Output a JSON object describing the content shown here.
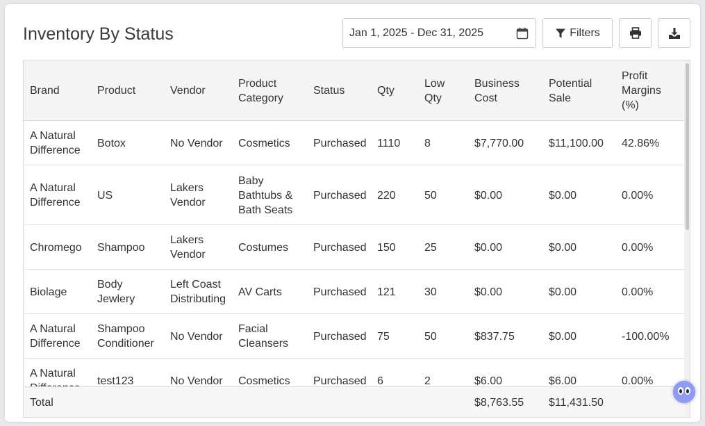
{
  "page": {
    "title": "Inventory By Status",
    "date_range": "Jan 1, 2025 - Dec 31, 2025",
    "filters_label": "Filters",
    "icons": {
      "calendar": "calendar-icon",
      "filter": "filter-icon",
      "print": "print-icon",
      "download": "download-icon"
    }
  },
  "table": {
    "headers": [
      "Brand",
      "Product",
      "Vendor",
      "Product Category",
      "Status",
      "Qty",
      "Low Qty",
      "Business Cost",
      "Potential Sale",
      "Profit Margins (%)"
    ],
    "rows": [
      [
        "A Natural Difference",
        "Botox",
        "No Vendor",
        "Cosmetics",
        "Purchased",
        "1110",
        "8",
        "$7,770.00",
        "$11,100.00",
        "42.86%"
      ],
      [
        "A Natural Difference",
        "US",
        "Lakers Vendor",
        "Baby Bathtubs & Bath Seats",
        "Purchased",
        "220",
        "50",
        "$0.00",
        "$0.00",
        "0.00%"
      ],
      [
        "Chromego",
        "Shampoo",
        "Lakers Vendor",
        "Costumes",
        "Purchased",
        "150",
        "25",
        "$0.00",
        "$0.00",
        "0.00%"
      ],
      [
        "Biolage",
        "Body Jewlery",
        "Left Coast Distributing",
        "AV Carts",
        "Purchased",
        "121",
        "30",
        "$0.00",
        "$0.00",
        "0.00%"
      ],
      [
        "A Natural Difference",
        "Shampoo Conditioner",
        "No Vendor",
        "Facial Cleansers",
        "Purchased",
        "75",
        "50",
        "$837.75",
        "$0.00",
        "-100.00%"
      ],
      [
        "A Natural Difference",
        "test123",
        "No Vendor",
        "Cosmetics",
        "Purchased",
        "6",
        "2",
        "$6.00",
        "$6.00",
        "0.00%"
      ]
    ],
    "footer": {
      "label": "Total",
      "business_cost": "$8,763.55",
      "potential_sale": "$11,431.50"
    }
  },
  "colors": {
    "header_bg": "#f5f5f5",
    "border": "#d9d9d9",
    "text": "#333333",
    "assistant_bubble": "#8e9bf0"
  }
}
